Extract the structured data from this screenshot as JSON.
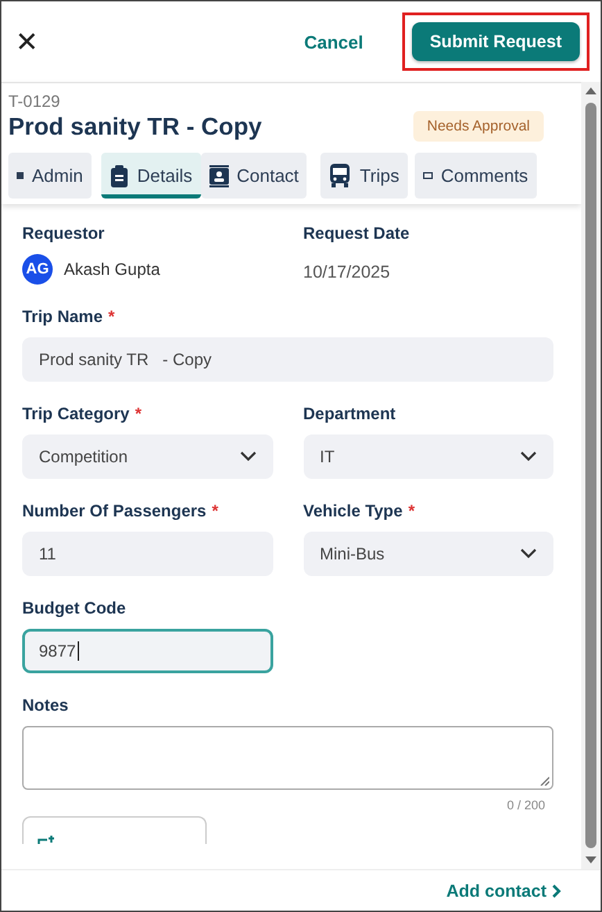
{
  "header": {
    "close": "✕",
    "cancel": "Cancel",
    "submit": {
      "label": "Submit Request",
      "highlighted": true
    }
  },
  "request": {
    "id": "T-0129",
    "title": "Prod sanity TR - Copy",
    "status": "Needs Approval"
  },
  "tabs": [
    {
      "label": "Admin",
      "selected": false
    },
    {
      "label": "Details",
      "selected": true
    },
    {
      "label": "Contact",
      "selected": false
    },
    {
      "label": "Trips",
      "selected": false
    },
    {
      "label": "Comments",
      "selected": false
    }
  ],
  "requestor": {
    "label": "Requestor",
    "initials": "AG",
    "name": "Akash Gupta"
  },
  "request_date": {
    "label": "Request Date",
    "value": "10/17/2025"
  },
  "rows": [
    [
      {
        "label": "Trip Name",
        "required_mark": "*",
        "kind": "text",
        "value": "Prod sanity TR   - Copy",
        "focused": false
      }
    ],
    [
      {
        "label": "Trip Category",
        "required_mark": "*",
        "kind": "select",
        "value": "Competition",
        "focused": false
      },
      {
        "label": "Department",
        "kind": "select",
        "value": "IT",
        "focused": false
      }
    ],
    [
      {
        "label": "Number Of Passengers",
        "required_mark": "*",
        "kind": "text",
        "value": "11",
        "focused": false
      },
      {
        "label": "Vehicle Type",
        "required_mark": "*",
        "kind": "select",
        "value": "Mini-Bus",
        "focused": false
      }
    ],
    [
      {
        "label": "Budget Code",
        "kind": "text",
        "value": "9877",
        "focused": true
      },
      {
        "kind": "empty"
      }
    ]
  ],
  "notes": {
    "label": "Notes",
    "counter": "0 / 200"
  },
  "footer": {
    "add_contact": "Add contact"
  }
}
